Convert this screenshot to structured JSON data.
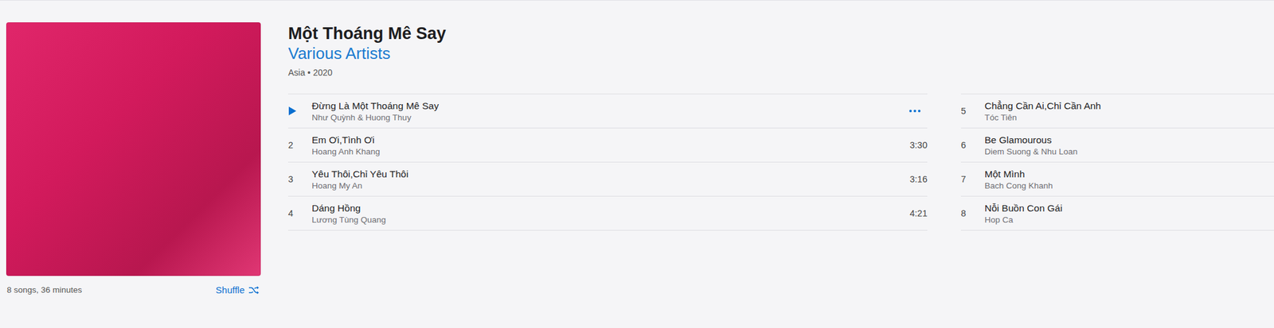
{
  "album": {
    "title": "Một Thoáng Mê Say",
    "artist": "Various Artists",
    "meta": "Asia • 2020",
    "summary": "8 songs, 36 minutes",
    "shuffle": "Shuffle"
  },
  "tracks": [
    {
      "title": "Đừng Là Một Thoáng Mê Say",
      "artist": "Như Quỳnh & Huong Thuy",
      "hovered": true
    },
    {
      "number": "2",
      "title": "Em Ơi,Tình Ơi",
      "artist": "Hoang Anh Khang",
      "duration": "3:30",
      "hovered": false
    },
    {
      "number": "3",
      "title": "Yêu Thôi,Chỉ Yêu Thôi",
      "artist": "Hoang My An",
      "duration": "3:16",
      "hovered": false
    },
    {
      "number": "4",
      "title": "Dáng Hồng",
      "artist": "Lương Tùng Quang",
      "duration": "4:21",
      "hovered": false
    },
    {
      "number": "5",
      "title": "Chẳng Cần Ai,Chỉ Cần Anh",
      "artist": "Tóc Tiên",
      "hovered": false
    },
    {
      "number": "6",
      "title": "Be Glamourous",
      "artist": "Diem Suong & Nhu Loan",
      "hovered": false
    },
    {
      "number": "7",
      "title": "Một Mình",
      "artist": "Bach Cong Khanh",
      "hovered": false
    },
    {
      "number": "8",
      "title": "Nỗi Buồn Con Gái",
      "artist": "Hop Ca",
      "hovered": false
    }
  ]
}
